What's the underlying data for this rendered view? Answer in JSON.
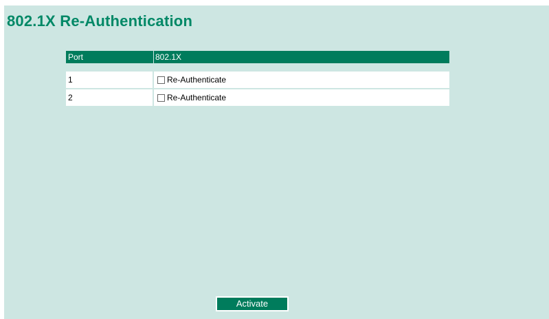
{
  "page": {
    "title": "802.1X Re-Authentication"
  },
  "table": {
    "headers": {
      "port": "Port",
      "dot1x": "802.1X"
    },
    "rows": [
      {
        "port": "1",
        "label": "Re-Authenticate",
        "checked": false
      },
      {
        "port": "2",
        "label": "Re-Authenticate",
        "checked": false
      }
    ]
  },
  "actions": {
    "activate_label": "Activate"
  },
  "colors": {
    "background": "#cde6e2",
    "accent": "#007c5c",
    "title": "#008866"
  }
}
